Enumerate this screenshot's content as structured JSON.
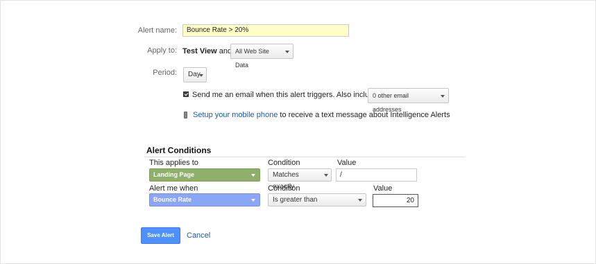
{
  "form": {
    "alert_name_label": "Alert name:",
    "alert_name_value": "Bounce Rate > 20%",
    "apply_to_label": "Apply to:",
    "view_name": "Test View",
    "and_word": "and",
    "data_dropdown": "All Web Site Data",
    "period_label": "Period:",
    "period_value": "Day",
    "email_text": "Send me an email when this alert triggers. Also include",
    "email_checked": true,
    "other_emails_dropdown": "0 other email addresses",
    "mobile_link": "Setup your mobile phone",
    "mobile_text": "to receive a text message about Intelligence Alerts"
  },
  "conditions": {
    "title": "Alert Conditions",
    "applies_to_label": "This applies to",
    "applies_condition_label": "Condition",
    "applies_value_label": "Value",
    "applies_dimension": "Landing Page",
    "applies_condition": "Matches exactly",
    "applies_value": "/",
    "alert_when_label": "Alert me when",
    "alert_condition_label": "Condition",
    "alert_value_label": "Value",
    "alert_metric": "Bounce Rate",
    "alert_condition": "Is greater than",
    "alert_value": "20"
  },
  "actions": {
    "save_label": "Save Alert",
    "cancel_label": "Cancel"
  },
  "colors": {
    "dimension_green": "#8fb06b",
    "metric_blue": "#8ba6f5",
    "primary_blue": "#4d90fe",
    "link_blue": "#1a5aa8",
    "name_field_yellow": "#ffffc8"
  }
}
